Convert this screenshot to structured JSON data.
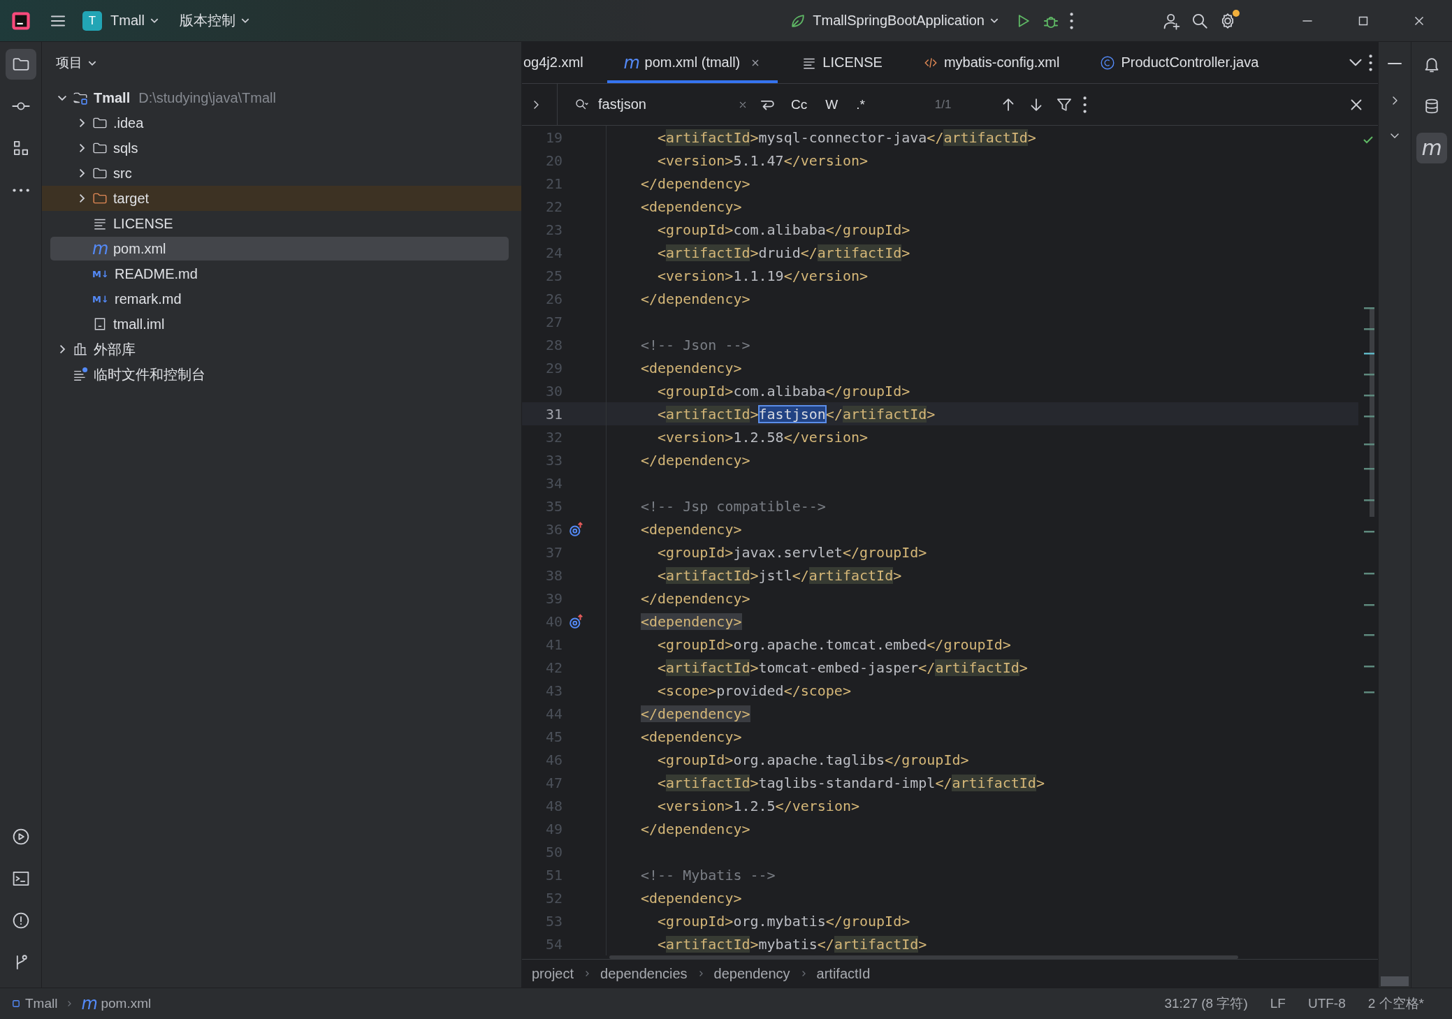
{
  "title_bar": {
    "project_badge": "T",
    "project": "Tmall",
    "vcs": "版本控制",
    "run_config": "TmallSpringBootApplication",
    "settings_update": true
  },
  "left_tools_top": [
    {
      "kind": "project",
      "selected": true
    },
    {
      "kind": "commit",
      "selected": false
    },
    {
      "kind": "structure",
      "selected": false
    },
    {
      "kind": "more",
      "selected": false
    }
  ],
  "left_tools_bottom": [
    {
      "kind": "run",
      "selected": false
    },
    {
      "kind": "terminal",
      "selected": false
    },
    {
      "kind": "problems",
      "selected": false
    },
    {
      "kind": "git",
      "selected": false
    }
  ],
  "right_tools": [
    {
      "kind": "notifications",
      "selected": false
    },
    {
      "kind": "database",
      "selected": false
    },
    {
      "kind": "maven",
      "glyph": "m",
      "selected": true
    }
  ],
  "project_panel": {
    "title": "项目",
    "tree": [
      {
        "label": "Tmall",
        "path": "D:\\studying\\java\\Tmall",
        "kind": "module",
        "expanded": true,
        "selected": false,
        "children": [
          {
            "label": ".idea",
            "kind": "folder",
            "expanded": false,
            "selected": false
          },
          {
            "label": "sqls",
            "kind": "folder",
            "expanded": false,
            "selected": false
          },
          {
            "label": "src",
            "kind": "folder",
            "expanded": false,
            "selected": false
          },
          {
            "label": "target",
            "kind": "excluded",
            "expanded": false,
            "selected": false
          },
          {
            "label": "LICENSE",
            "kind": "text",
            "selected": false
          },
          {
            "label": "pom.xml",
            "kind": "maven",
            "glyph": "m",
            "selected": true
          },
          {
            "label": "README.md",
            "kind": "markdown",
            "glyph": "M↓",
            "selected": false
          },
          {
            "label": "remark.md",
            "kind": "markdown",
            "glyph": "M↓",
            "selected": false
          },
          {
            "label": "tmall.iml",
            "kind": "iml",
            "selected": false
          }
        ]
      },
      {
        "label": "外部库",
        "kind": "library",
        "expanded": false,
        "selected": false
      },
      {
        "label": "临时文件和控制台",
        "kind": "scratch",
        "selected": false
      }
    ]
  },
  "tabs": [
    {
      "label": "og4j2.xml",
      "kind": "plain",
      "selected": false
    },
    {
      "label": "pom.xml (tmall)",
      "kind": "maven",
      "glyph": "m",
      "selected": true
    },
    {
      "label": "LICENSE",
      "kind": "text",
      "selected": false
    },
    {
      "label": "mybatis-config.xml",
      "kind": "xml",
      "selected": false
    },
    {
      "label": "ProductController.java",
      "kind": "class",
      "selected": false
    }
  ],
  "search": {
    "query": "fastjson",
    "options": [
      "Cc",
      "W",
      ".*"
    ],
    "count": "1/1"
  },
  "lines": [
    {
      "number": "19",
      "kind": "property",
      "current": false,
      "marker": false,
      "segments": [
        {
          "text": "<",
          "kind": "tag"
        },
        {
          "text": "artifactId",
          "kind": "mark"
        },
        {
          "text": ">",
          "kind": "tag"
        },
        {
          "text": "mysql-connector-java",
          "kind": "value"
        },
        {
          "text": "</",
          "kind": "tag"
        },
        {
          "text": "artifactId",
          "kind": "mark"
        },
        {
          "text": ">",
          "kind": "tag"
        }
      ]
    },
    {
      "number": "20",
      "kind": "property",
      "current": false,
      "marker": false,
      "segments": [
        {
          "text": "<version>",
          "kind": "tag"
        },
        {
          "text": "5.1.47",
          "kind": "value"
        },
        {
          "text": "</version>",
          "kind": "tag"
        }
      ]
    },
    {
      "number": "21",
      "kind": "element",
      "current": false,
      "marker": false,
      "segments": [
        {
          "text": "</dependency>",
          "kind": "tag"
        }
      ]
    },
    {
      "number": "22",
      "kind": "element",
      "current": false,
      "marker": false,
      "segments": [
        {
          "text": "<dependency>",
          "kind": "tag"
        }
      ]
    },
    {
      "number": "23",
      "kind": "property",
      "current": false,
      "marker": false,
      "segments": [
        {
          "text": "<groupId>",
          "kind": "tag"
        },
        {
          "text": "com.alibaba",
          "kind": "value"
        },
        {
          "text": "</groupId>",
          "kind": "tag"
        }
      ]
    },
    {
      "number": "24",
      "kind": "property",
      "current": false,
      "marker": false,
      "segments": [
        {
          "text": "<",
          "kind": "tag"
        },
        {
          "text": "artifactId",
          "kind": "mark"
        },
        {
          "text": ">",
          "kind": "tag"
        },
        {
          "text": "druid",
          "kind": "value"
        },
        {
          "text": "</",
          "kind": "tag"
        },
        {
          "text": "artifactId",
          "kind": "mark"
        },
        {
          "text": ">",
          "kind": "tag"
        }
      ]
    },
    {
      "number": "25",
      "kind": "property",
      "current": false,
      "marker": false,
      "segments": [
        {
          "text": "<version>",
          "kind": "tag"
        },
        {
          "text": "1.1.19",
          "kind": "value"
        },
        {
          "text": "</version>",
          "kind": "tag"
        }
      ]
    },
    {
      "number": "26",
      "kind": "element",
      "current": false,
      "marker": false,
      "segments": [
        {
          "text": "</dependency>",
          "kind": "tag"
        }
      ]
    },
    {
      "number": "27",
      "kind": "blank",
      "current": false,
      "marker": false
    },
    {
      "number": "28",
      "kind": "element",
      "current": false,
      "marker": false,
      "segments": [
        {
          "text": "<!-- Json -->",
          "kind": "comment"
        }
      ]
    },
    {
      "number": "29",
      "kind": "element",
      "current": false,
      "marker": false,
      "segments": [
        {
          "text": "<dependency>",
          "kind": "tag"
        }
      ]
    },
    {
      "number": "30",
      "kind": "property",
      "current": false,
      "marker": false,
      "segments": [
        {
          "text": "<groupId>",
          "kind": "tag"
        },
        {
          "text": "com.alibaba",
          "kind": "value"
        },
        {
          "text": "</groupId>",
          "kind": "tag"
        }
      ]
    },
    {
      "number": "31",
      "kind": "property",
      "current": true,
      "marker": false,
      "segments": [
        {
          "text": "<",
          "kind": "tag"
        },
        {
          "text": "artifactId",
          "kind": "mark"
        },
        {
          "text": ">",
          "kind": "tag"
        },
        {
          "text": "fastjson",
          "kind": "found"
        },
        {
          "text": "</",
          "kind": "tag"
        },
        {
          "text": "artifactId",
          "kind": "mark"
        },
        {
          "text": ">",
          "kind": "tag"
        }
      ]
    },
    {
      "number": "32",
      "kind": "property",
      "current": false,
      "marker": false,
      "segments": [
        {
          "text": "<version>",
          "kind": "tag"
        },
        {
          "text": "1.2.58",
          "kind": "value"
        },
        {
          "text": "</version>",
          "kind": "tag"
        }
      ]
    },
    {
      "number": "33",
      "kind": "element",
      "current": false,
      "marker": false,
      "segments": [
        {
          "text": "</dependency>",
          "kind": "tag"
        }
      ]
    },
    {
      "number": "34",
      "kind": "blank",
      "current": false,
      "marker": false
    },
    {
      "number": "35",
      "kind": "element",
      "current": false,
      "marker": false,
      "segments": [
        {
          "text": "<!-- Jsp compatible-->",
          "kind": "comment"
        }
      ]
    },
    {
      "number": "36",
      "kind": "element",
      "current": false,
      "marker": true,
      "segments": [
        {
          "text": "<dependency>",
          "kind": "tag"
        }
      ]
    },
    {
      "number": "37",
      "kind": "property",
      "current": false,
      "marker": false,
      "segments": [
        {
          "text": "<groupId>",
          "kind": "tag"
        },
        {
          "text": "javax.servlet",
          "kind": "value"
        },
        {
          "text": "</groupId>",
          "kind": "tag"
        }
      ]
    },
    {
      "number": "38",
      "kind": "property",
      "current": false,
      "marker": false,
      "segments": [
        {
          "text": "<",
          "kind": "tag"
        },
        {
          "text": "artifactId",
          "kind": "mark"
        },
        {
          "text": ">",
          "kind": "tag"
        },
        {
          "text": "jstl",
          "kind": "value"
        },
        {
          "text": "</",
          "kind": "tag"
        },
        {
          "text": "artifactId",
          "kind": "mark"
        },
        {
          "text": ">",
          "kind": "tag"
        }
      ]
    },
    {
      "number": "39",
      "kind": "element",
      "current": false,
      "marker": false,
      "segments": [
        {
          "text": "</dependency>",
          "kind": "tag"
        }
      ]
    },
    {
      "number": "40",
      "kind": "element",
      "current": false,
      "marker": true,
      "segments": [
        {
          "text": "<dependency>",
          "kind": "pair"
        }
      ]
    },
    {
      "number": "41",
      "kind": "property",
      "current": false,
      "marker": false,
      "segments": [
        {
          "text": "<groupId>",
          "kind": "tag"
        },
        {
          "text": "org.apache.tomcat.embed",
          "kind": "value"
        },
        {
          "text": "</groupId>",
          "kind": "tag"
        }
      ]
    },
    {
      "number": "42",
      "kind": "property",
      "current": false,
      "marker": false,
      "segments": [
        {
          "text": "<",
          "kind": "tag"
        },
        {
          "text": "artifactId",
          "kind": "mark"
        },
        {
          "text": ">",
          "kind": "tag"
        },
        {
          "text": "tomcat-embed-jasper",
          "kind": "value"
        },
        {
          "text": "</",
          "kind": "tag"
        },
        {
          "text": "artifactId",
          "kind": "mark"
        },
        {
          "text": ">",
          "kind": "tag"
        }
      ]
    },
    {
      "number": "43",
      "kind": "property",
      "current": false,
      "marker": false,
      "segments": [
        {
          "text": "<scope>",
          "kind": "tag"
        },
        {
          "text": "provided",
          "kind": "value"
        },
        {
          "text": "</scope>",
          "kind": "tag"
        }
      ]
    },
    {
      "number": "44",
      "kind": "element",
      "current": false,
      "marker": false,
      "segments": [
        {
          "text": "</dependency>",
          "kind": "pair"
        }
      ]
    },
    {
      "number": "45",
      "kind": "element",
      "current": false,
      "marker": false,
      "segments": [
        {
          "text": "<dependency>",
          "kind": "tag"
        }
      ]
    },
    {
      "number": "46",
      "kind": "property",
      "current": false,
      "marker": false,
      "segments": [
        {
          "text": "<groupId>",
          "kind": "tag"
        },
        {
          "text": "org.apache.taglibs",
          "kind": "value"
        },
        {
          "text": "</groupId>",
          "kind": "tag"
        }
      ]
    },
    {
      "number": "47",
      "kind": "property",
      "current": false,
      "marker": false,
      "segments": [
        {
          "text": "<",
          "kind": "tag"
        },
        {
          "text": "artifactId",
          "kind": "mark"
        },
        {
          "text": ">",
          "kind": "tag"
        },
        {
          "text": "taglibs-standard-impl",
          "kind": "value"
        },
        {
          "text": "</",
          "kind": "tag"
        },
        {
          "text": "artifactId",
          "kind": "mark"
        },
        {
          "text": ">",
          "kind": "tag"
        }
      ]
    },
    {
      "number": "48",
      "kind": "property",
      "current": false,
      "marker": false,
      "segments": [
        {
          "text": "<version>",
          "kind": "tag"
        },
        {
          "text": "1.2.5",
          "kind": "value"
        },
        {
          "text": "</version>",
          "kind": "tag"
        }
      ]
    },
    {
      "number": "49",
      "kind": "element",
      "current": false,
      "marker": false,
      "segments": [
        {
          "text": "</dependency>",
          "kind": "tag"
        }
      ]
    },
    {
      "number": "50",
      "kind": "blank",
      "current": false,
      "marker": false
    },
    {
      "number": "51",
      "kind": "element",
      "current": false,
      "marker": false,
      "segments": [
        {
          "text": "<!-- Mybatis -->",
          "kind": "comment"
        }
      ]
    },
    {
      "number": "52",
      "kind": "element",
      "current": false,
      "marker": false,
      "segments": [
        {
          "text": "<dependency>",
          "kind": "tag"
        }
      ]
    },
    {
      "number": "53",
      "kind": "property",
      "current": false,
      "marker": false,
      "segments": [
        {
          "text": "<groupId>",
          "kind": "tag"
        },
        {
          "text": "org.mybatis",
          "kind": "value"
        },
        {
          "text": "</groupId>",
          "kind": "tag"
        }
      ]
    },
    {
      "number": "54",
      "kind": "property",
      "current": false,
      "marker": false,
      "segments": [
        {
          "text": "<",
          "kind": "tag"
        },
        {
          "text": "artifactId",
          "kind": "mark"
        },
        {
          "text": ">",
          "kind": "tag"
        },
        {
          "text": "mybatis",
          "kind": "value"
        },
        {
          "text": "</",
          "kind": "tag"
        },
        {
          "text": "artifactId",
          "kind": "mark"
        },
        {
          "text": ">",
          "kind": "tag"
        }
      ]
    }
  ],
  "breadcrumbs": [
    "project",
    "dependencies",
    "dependency",
    "artifactId"
  ],
  "status_bar": {
    "path": [
      {
        "label": "Tmall",
        "kind": "module"
      },
      {
        "label": "pom.xml",
        "kind": "maven",
        "glyph": "m"
      }
    ],
    "items": [
      "31:27 (8 字符)",
      "LF",
      "UTF-8",
      "2 个空格*"
    ]
  }
}
